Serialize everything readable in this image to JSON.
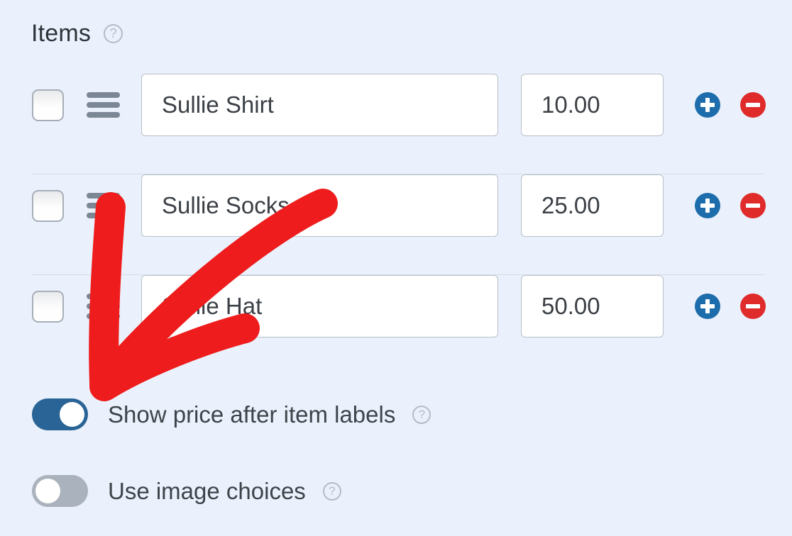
{
  "section": {
    "title": "Items",
    "help_icon": "question-circle-icon"
  },
  "items": [
    {
      "label": "Sullie Shirt",
      "price": "10.00",
      "checked": false,
      "add_label": "+",
      "remove_label": "–"
    },
    {
      "label": "Sullie Socks",
      "price": "25.00",
      "checked": false,
      "add_label": "+",
      "remove_label": "–"
    },
    {
      "label": "Sullie Hat",
      "price": "50.00",
      "checked": false,
      "add_label": "+",
      "remove_label": "–"
    }
  ],
  "toggles": [
    {
      "label": "Show price after item labels",
      "state": "on",
      "help_icon": "question-circle-icon"
    },
    {
      "label": "Use image choices",
      "state": "off",
      "help_icon": "question-circle-icon"
    }
  ],
  "annotation": {
    "type": "arrow",
    "shape": "checkmark-arrow",
    "color": "#ee1c1c",
    "points_to": "Show price after item labels"
  },
  "colors": {
    "background": "#eaf1fc",
    "add_button": "#1d6cab",
    "remove_button": "#e02b2b",
    "toggle_on": "#2a6496",
    "toggle_off": "#aab2bd",
    "annotation_red": "#ee1c1c",
    "text": "#3c4349",
    "divider": "#d8dee6"
  }
}
